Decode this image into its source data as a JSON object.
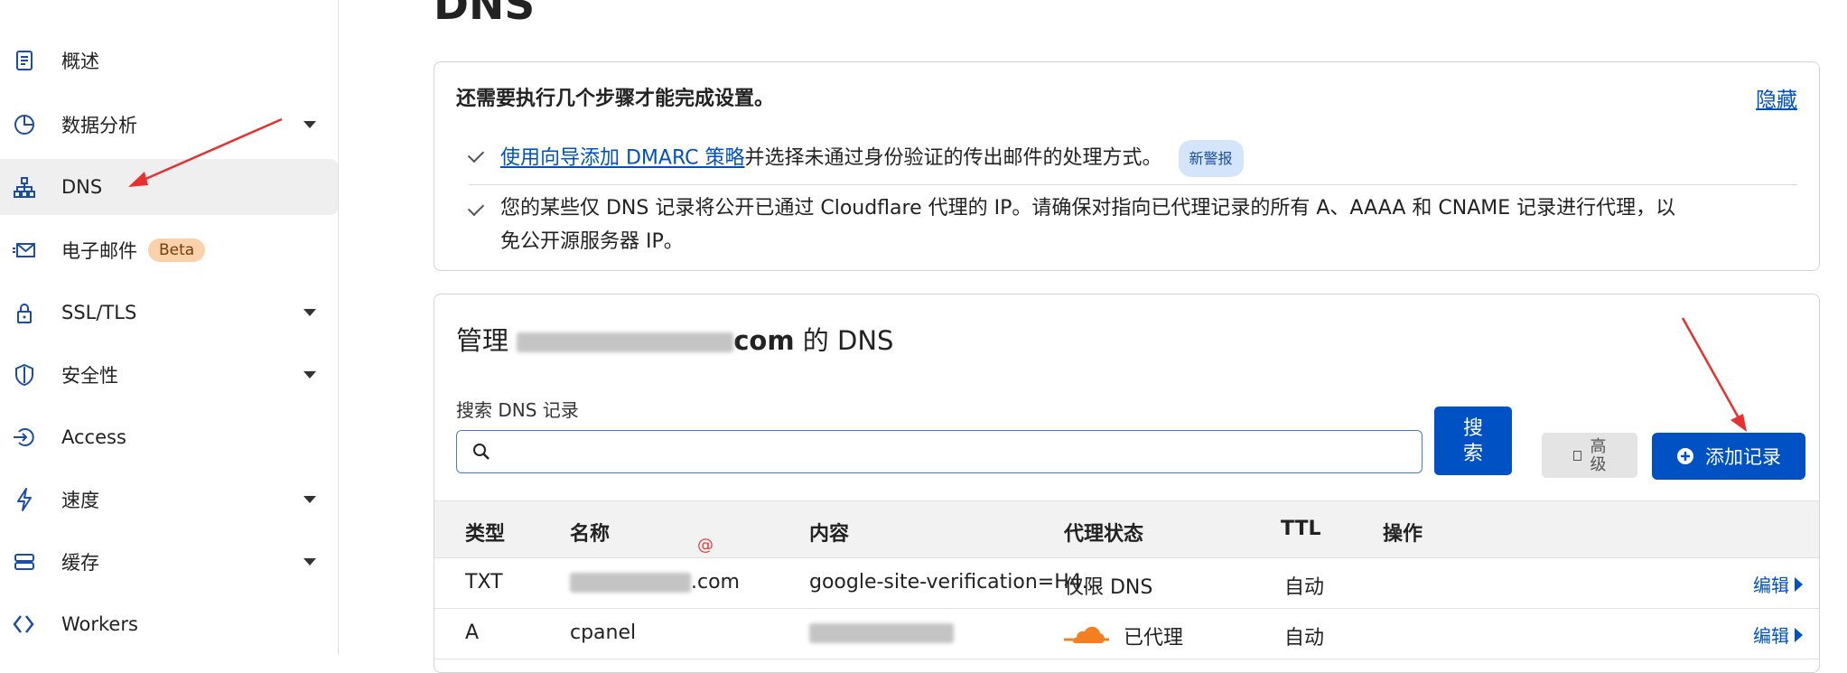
{
  "sidebar": {
    "items": [
      {
        "label": "概述",
        "icon": "document-icon",
        "has_caret": false
      },
      {
        "label": "数据分析",
        "icon": "pie-chart-icon",
        "has_caret": true
      },
      {
        "label": "DNS",
        "icon": "sitemap-icon",
        "has_caret": false,
        "active": true
      },
      {
        "label": "电子邮件",
        "icon": "email-icon",
        "has_caret": false,
        "badge": "Beta"
      },
      {
        "label": "SSL/TLS",
        "icon": "lock-icon",
        "has_caret": true
      },
      {
        "label": "安全性",
        "icon": "shield-icon",
        "has_caret": true
      },
      {
        "label": "Access",
        "icon": "access-icon",
        "has_caret": false
      },
      {
        "label": "速度",
        "icon": "lightning-icon",
        "has_caret": true
      },
      {
        "label": "缓存",
        "icon": "database-icon",
        "has_caret": true
      },
      {
        "label": "Workers",
        "icon": "workers-icon",
        "has_caret": false
      }
    ]
  },
  "page": {
    "title": "DNS"
  },
  "notice": {
    "title": "还需要执行几个步骤才能完成设置。",
    "hide": "隐藏",
    "item1_link": "使用向导添加 DMARC 策略",
    "item1_text": "并选择未通过身份验证的传出邮件的处理方式。",
    "item1_badge": "新警报",
    "item2_line1": "您的某些仅 DNS 记录将公开已通过 Cloudflare 代理的 IP。请确保对指向已代理记录的所有 A、AAAA 和 CNAME 记录进行代理，以",
    "item2_line2": "免公开源服务器 IP。"
  },
  "dns": {
    "title_prefix": "管理",
    "title_domain_suffix": "com",
    "title_suffix": "的 DNS",
    "search_label": "搜索 DNS 记录",
    "search_value": "",
    "search_button": "搜\n索",
    "advanced_button": "高\n级",
    "add_button": "添加记录",
    "columns": [
      "类型",
      "名称",
      "内容",
      "代理状态",
      "TTL",
      "操作"
    ],
    "rows": [
      {
        "type": "TXT",
        "name": ".com",
        "content": "google-site-verification=H4...",
        "proxy": "仅限 DNS",
        "ttl": "自动",
        "action": "编辑"
      },
      {
        "type": "A",
        "name": "cpanel",
        "content": "",
        "proxy": "已代理",
        "ttl": "自动",
        "action": "编辑"
      }
    ],
    "at_mark": "@"
  },
  "colors": {
    "accent": "#0051c3",
    "annotation": "#e83030",
    "cloud": "#f38020"
  }
}
